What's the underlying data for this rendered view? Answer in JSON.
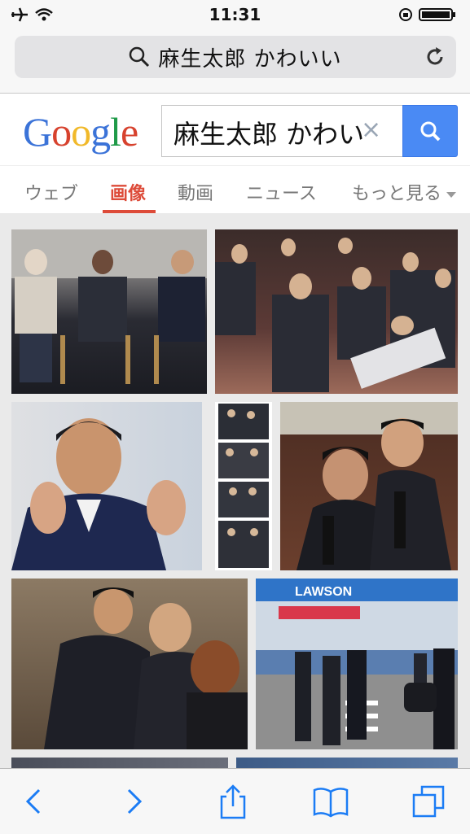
{
  "status_bar": {
    "time": "11:31"
  },
  "browser": {
    "address_text": "麻生太郎 かわいい"
  },
  "google": {
    "logo_letters": [
      "G",
      "o",
      "o",
      "g",
      "l",
      "e"
    ],
    "logo_colors": [
      "#3b73d8",
      "#d7422e",
      "#f1b92a",
      "#3b73d8",
      "#1f9a48",
      "#d7422e"
    ],
    "search_value": "麻生太郎 かわい"
  },
  "tabs": [
    {
      "label": "ウェブ",
      "active": false
    },
    {
      "label": "画像",
      "active": true
    },
    {
      "label": "動画",
      "active": false
    },
    {
      "label": "ニュース",
      "active": false
    },
    {
      "label": "もっと見る",
      "active": false
    }
  ],
  "images": [
    {
      "alt": "photo-1"
    },
    {
      "alt": "photo-2"
    },
    {
      "alt": "photo-3"
    },
    {
      "alt": "photo-4"
    },
    {
      "alt": "photo-5"
    },
    {
      "alt": "photo-6"
    },
    {
      "alt": "photo-7"
    }
  ],
  "store_sign_text": "LAWSON",
  "colors": {
    "accent_red": "#dd4b39",
    "google_blue": "#4a8af4",
    "ios_blue": "#1b7cf5"
  }
}
